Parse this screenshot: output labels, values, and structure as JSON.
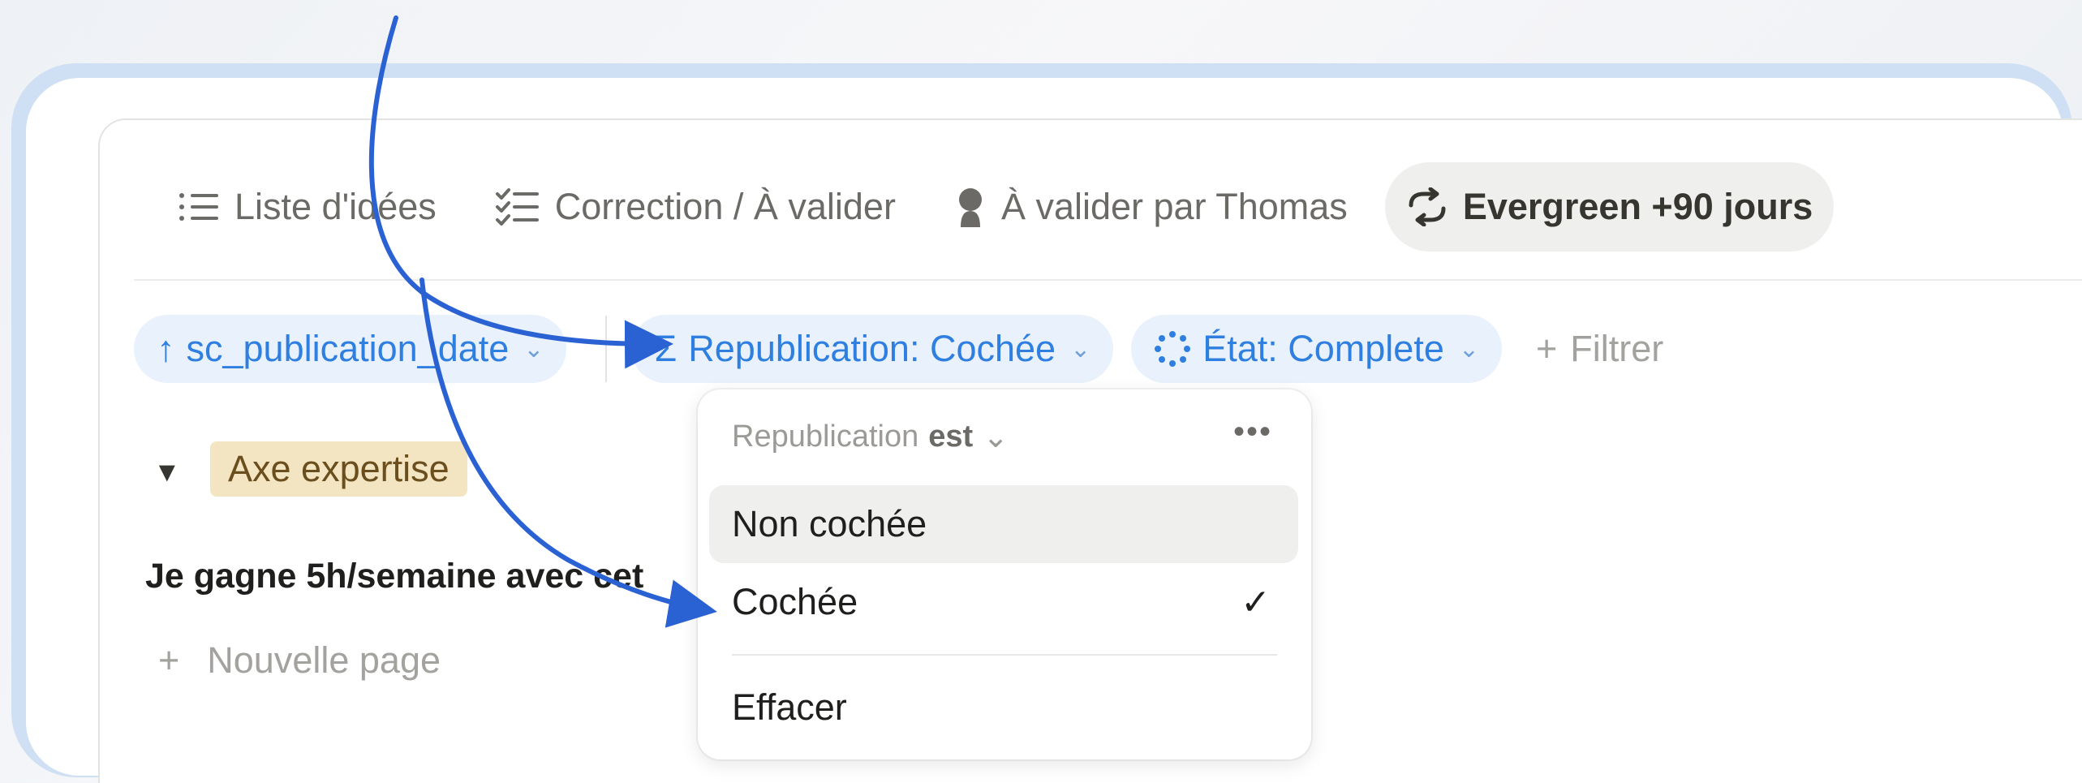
{
  "tabs": [
    {
      "label": "Liste d'idées",
      "icon": "list-icon",
      "active": false
    },
    {
      "label": "Correction / À valider",
      "icon": "checklist-icon",
      "active": false
    },
    {
      "label": "À valider par Thomas",
      "icon": "person-icon",
      "active": false
    },
    {
      "label": "Evergreen +90 jours",
      "icon": "repeat-icon",
      "active": true
    }
  ],
  "filters": {
    "sort": {
      "arrow": "↑",
      "label": "sc_publication_date",
      "chevron": "⌄"
    },
    "republication": {
      "icon": "Σ",
      "label": "Republication: Cochée",
      "chevron": "⌄"
    },
    "etat": {
      "label": "État: Complete",
      "chevron": "⌄"
    },
    "add": {
      "plus": "+",
      "label": "Filtrer"
    }
  },
  "group": {
    "toggle": "▼",
    "tag": "Axe expertise"
  },
  "row": {
    "title": "Je gagne 5h/semaine avec cet"
  },
  "new_page": {
    "plus": "+",
    "label": "Nouvelle page"
  },
  "dropdown": {
    "property": "Republication",
    "operator": "est",
    "operator_chevron": "⌄",
    "more": "•••",
    "options": [
      {
        "label": "Non cochée",
        "hover": true,
        "checked": false
      },
      {
        "label": "Cochée",
        "hover": false,
        "checked": true,
        "check": "✓"
      }
    ],
    "clear_label": "Effacer"
  },
  "colors": {
    "filter_blue": "#2f7fe0",
    "pill_bg": "#e8f1fc",
    "tag_bg": "#f4e5c2",
    "arrow": "#2b62d3",
    "frame": "#cfe0f4"
  }
}
